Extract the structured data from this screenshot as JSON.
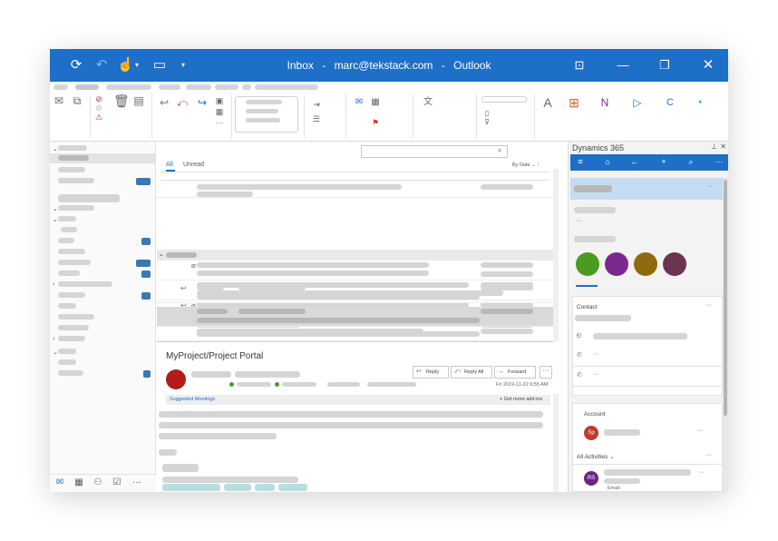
{
  "window": {
    "title_folder": "Inbox",
    "title_account": "marc@tekstack.com",
    "title_separator": "-",
    "title_app": "Outlook"
  },
  "icons": {
    "sync": "sync-icon",
    "undo": "undo-icon",
    "touch": "touch-mode-icon",
    "folder": "folder-icon",
    "restore": "restore-icon",
    "minimize": "minimize-icon",
    "maximize": "maximize-icon",
    "close": "close-icon"
  },
  "mail_list": {
    "tab_all": "All",
    "tab_unread": "Unread",
    "sort_label": "By Date",
    "sort_arrow": "↑"
  },
  "reading_pane": {
    "subject": "MyProject/Project Portal",
    "reply_label": "Reply",
    "reply_all_label": "Reply All",
    "forward_label": "Forward",
    "more_label": "···",
    "date_label": "Fri 2019-11-22 9:55 AM",
    "suggested_meetings": "Suggested Meetings",
    "get_addins": "Get more add-ins"
  },
  "dynamics": {
    "title": "Dynamics 365",
    "contact_label": "Contact",
    "account_label": "Account",
    "account_initials": "Sp",
    "activities_label": "All Activities",
    "activity_initials": "RS",
    "activity_type": "Email",
    "more_label": "···",
    "ellipsis": "···",
    "pin": "⊥",
    "close": "✕",
    "circle_colors": [
      "#4a9b1f",
      "#7a2a8c",
      "#8f6b10",
      "#6b3450"
    ]
  },
  "colors": {
    "accent": "#1e6fc8",
    "selected_row": "#d9d9d9"
  }
}
